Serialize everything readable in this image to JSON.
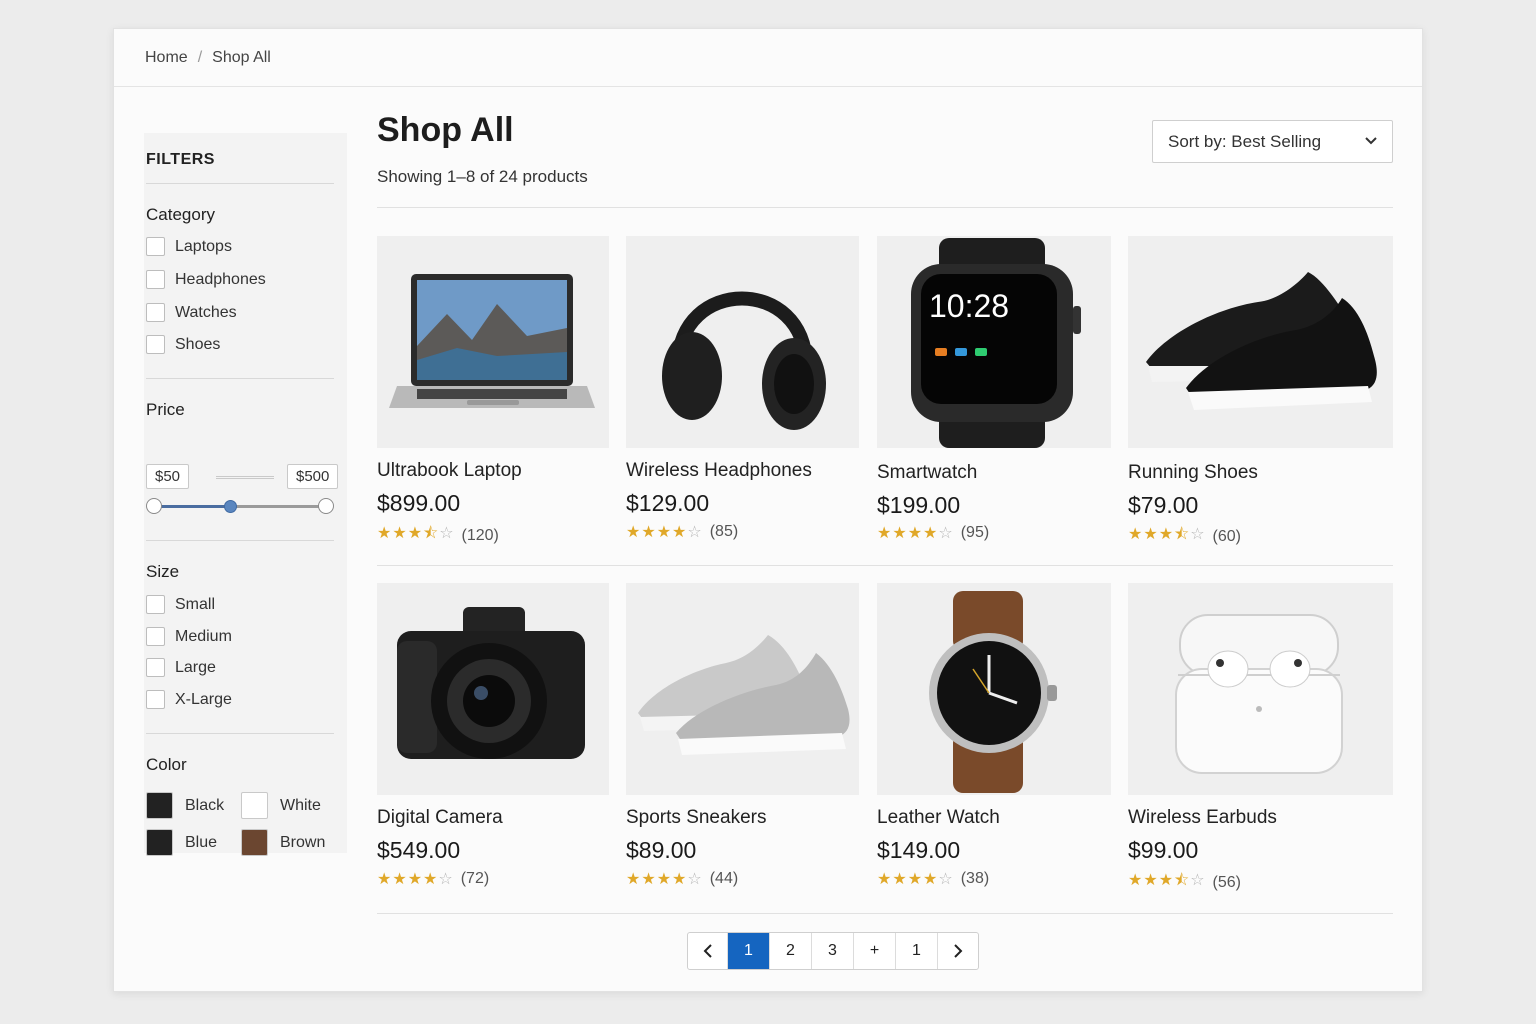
{
  "breadcrumb": {
    "home": "Home",
    "separator": "/",
    "current": "Shop All"
  },
  "filters": {
    "title": "FILTERS",
    "category": {
      "heading": "Category",
      "options": [
        "Laptops",
        "Headphones",
        "Watches",
        "Shoes"
      ]
    },
    "price": {
      "heading": "Price",
      "min": "$50",
      "max": "$500",
      "slider_value_fraction": 0.44
    },
    "size": {
      "heading": "Size",
      "options": [
        "Small",
        "Medium",
        "Large",
        "X-Large"
      ]
    },
    "color": {
      "heading": "Color",
      "options": [
        {
          "label": "Black",
          "hex": "#222222"
        },
        {
          "label": "White",
          "hex": "#ffffff"
        },
        {
          "label": "Blue",
          "hex": "#222222"
        },
        {
          "label": "Brown",
          "hex": "#6b4630"
        }
      ]
    }
  },
  "main": {
    "title": "Shop All",
    "count": "Showing 1–8 of 24 products",
    "sort_label": "Sort by: Best Selling"
  },
  "products": [
    {
      "name": "Ultrabook Laptop",
      "price": "$899.00",
      "stars": 3.5,
      "reviews": "(120)",
      "image": "laptop"
    },
    {
      "name": "Wireless Headphones",
      "price": "$129.00",
      "stars": 4,
      "reviews": "(85)",
      "image": "headphones"
    },
    {
      "name": "Smartwatch",
      "price": "$199.00",
      "stars": 4,
      "reviews": "(95)",
      "image": "smartwatch",
      "watch_time": "10:28"
    },
    {
      "name": "Running Shoes",
      "price": "$79.00",
      "stars": 3.5,
      "reviews": "(60)",
      "image": "running-shoes"
    },
    {
      "name": "Digital Camera",
      "price": "$549.00",
      "stars": 4,
      "reviews": "(72)",
      "image": "camera"
    },
    {
      "name": "Sports Sneakers",
      "price": "$89.00",
      "stars": 4,
      "reviews": "(44)",
      "image": "sneakers"
    },
    {
      "name": "Leather Watch",
      "price": "$149.00",
      "stars": 4,
      "reviews": "(38)",
      "image": "leather-watch"
    },
    {
      "name": "Wireless Earbuds",
      "price": "$99.00",
      "stars": 3.5,
      "reviews": "(56)",
      "image": "earbuds"
    }
  ],
  "pagination": {
    "prev_icon": "chevron-left-icon",
    "next_icon": "chevron-right-icon",
    "pages": [
      "1",
      "2",
      "3",
      "+",
      "1"
    ],
    "active_index": 0
  },
  "colors": {
    "accent": "#1565c0",
    "star": "#e0a829",
    "slider": "#4a6da0"
  }
}
